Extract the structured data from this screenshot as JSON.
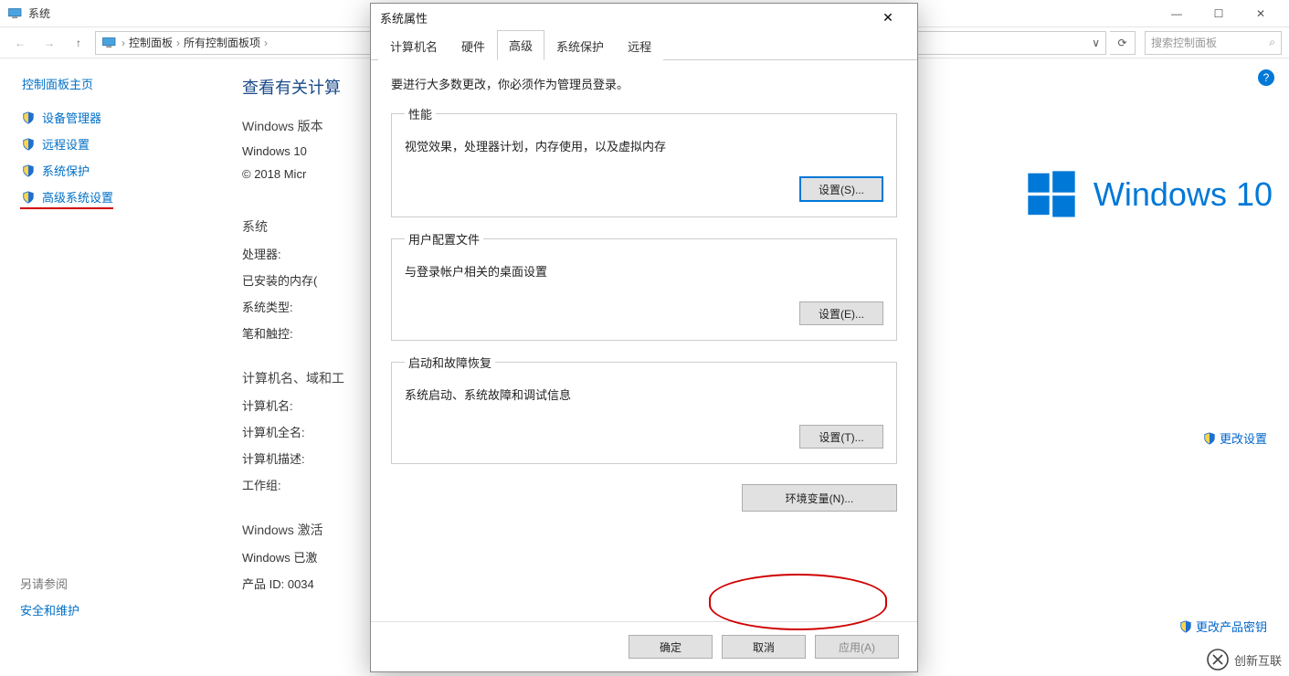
{
  "explorer": {
    "title": "系统",
    "win_controls": {
      "min": "—",
      "max": "☐",
      "close": "✕"
    },
    "nav": {
      "back": "←",
      "forward": "→",
      "up": "↑"
    },
    "breadcrumb": {
      "icon": "pc",
      "items": [
        "控制面板",
        "所有控制面板项"
      ],
      "sep": "›",
      "dropdown": "∨"
    },
    "refresh": "⟳",
    "search": {
      "placeholder": "搜索控制面板",
      "icon": "⌕"
    },
    "help_icon": "?"
  },
  "sidebar": {
    "home": "控制面板主页",
    "links": [
      {
        "label": "设备管理器"
      },
      {
        "label": "远程设置"
      },
      {
        "label": "系统保护"
      },
      {
        "label": "高级系统设置",
        "annotated": true
      }
    ],
    "see_also_label": "另请参阅",
    "see_also_link": "安全和维护"
  },
  "main": {
    "heading": "查看有关计算",
    "sections": {
      "win_edition_title": "Windows 版本",
      "win_edition_line1": "Windows 10",
      "win_edition_line2": "© 2018 Micr",
      "system_title": "系统",
      "processor_label": "处理器:",
      "ram_label": "已安装的内存(",
      "system_type_label": "系统类型:",
      "pen_touch_label": "笔和触控:",
      "computer_group_title": "计算机名、域和工",
      "computer_name_label": "计算机名:",
      "full_name_label": "计算机全名:",
      "desc_label": "计算机描述:",
      "workgroup_label": "工作组:",
      "activation_title": "Windows 激活",
      "activation_line": "Windows 已激",
      "product_id_label": "产品 ID: 0034"
    },
    "brand_text": "Windows 10",
    "change_settings": "更改设置",
    "change_product_key": "更改产品密钥"
  },
  "dialog": {
    "title": "系统属性",
    "close": "✕",
    "tabs": [
      {
        "label": "计算机名"
      },
      {
        "label": "硬件"
      },
      {
        "label": "高级",
        "active": true
      },
      {
        "label": "系统保护"
      },
      {
        "label": "远程"
      }
    ],
    "admin_note": "要进行大多数更改，你必须作为管理员登录。",
    "groups": {
      "performance": {
        "legend": "性能",
        "desc": "视觉效果，处理器计划，内存使用，以及虚拟内存",
        "button": "设置(S)..."
      },
      "user_profiles": {
        "legend": "用户配置文件",
        "desc": "与登录帐户相关的桌面设置",
        "button": "设置(E)..."
      },
      "startup": {
        "legend": "启动和故障恢复",
        "desc": "系统启动、系统故障和调试信息",
        "button": "设置(T)..."
      }
    },
    "env_var_button": "环境变量(N)...",
    "footer": {
      "ok": "确定",
      "cancel": "取消",
      "apply": "应用(A)"
    }
  },
  "watermark": "创新互联"
}
